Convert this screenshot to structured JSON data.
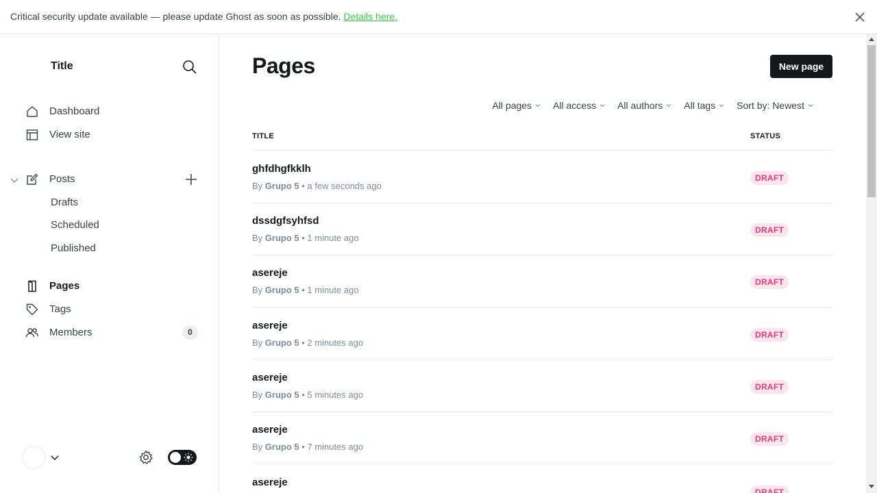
{
  "banner": {
    "text": "Critical security update available — please update Ghost as soon as possible.",
    "link": "Details here."
  },
  "sidebar": {
    "site_title": "Title",
    "nav": {
      "dashboard": "Dashboard",
      "view_site": "View site",
      "posts": "Posts",
      "drafts": "Drafts",
      "scheduled": "Scheduled",
      "published": "Published",
      "pages": "Pages",
      "tags": "Tags",
      "members": "Members",
      "members_count": "0"
    }
  },
  "main": {
    "title": "Pages",
    "new_button": "New page",
    "filters": [
      "All pages",
      "All access",
      "All authors",
      "All tags",
      "Sort by: Newest"
    ],
    "columns": {
      "title": "TITLE",
      "status": "STATUS"
    },
    "rows": [
      {
        "title": "ghfdhgfkklh",
        "by": "By",
        "author": "Grupo 5",
        "time": "• a few seconds ago",
        "status": "DRAFT"
      },
      {
        "title": "dssdgfsyhfsd",
        "by": "By",
        "author": "Grupo 5",
        "time": "• 1 minute ago",
        "status": "DRAFT"
      },
      {
        "title": "asereje",
        "by": "By",
        "author": "Grupo 5",
        "time": "• 1 minute ago",
        "status": "DRAFT"
      },
      {
        "title": "asereje",
        "by": "By",
        "author": "Grupo 5",
        "time": "• 2 minutes ago",
        "status": "DRAFT"
      },
      {
        "title": "asereje",
        "by": "By",
        "author": "Grupo 5",
        "time": "• 5 minutes ago",
        "status": "DRAFT"
      },
      {
        "title": "asereje",
        "by": "By",
        "author": "Grupo 5",
        "time": "• 7 minutes ago",
        "status": "DRAFT"
      },
      {
        "title": "asereje",
        "by": "",
        "author": "",
        "time": "",
        "status": "DRAFT"
      }
    ]
  },
  "colors": {
    "accent_link": "#30cf43",
    "draft_badge_bg": "#fbe4ee",
    "draft_badge_text": "#e23c77",
    "primary_button": "#15171a"
  }
}
